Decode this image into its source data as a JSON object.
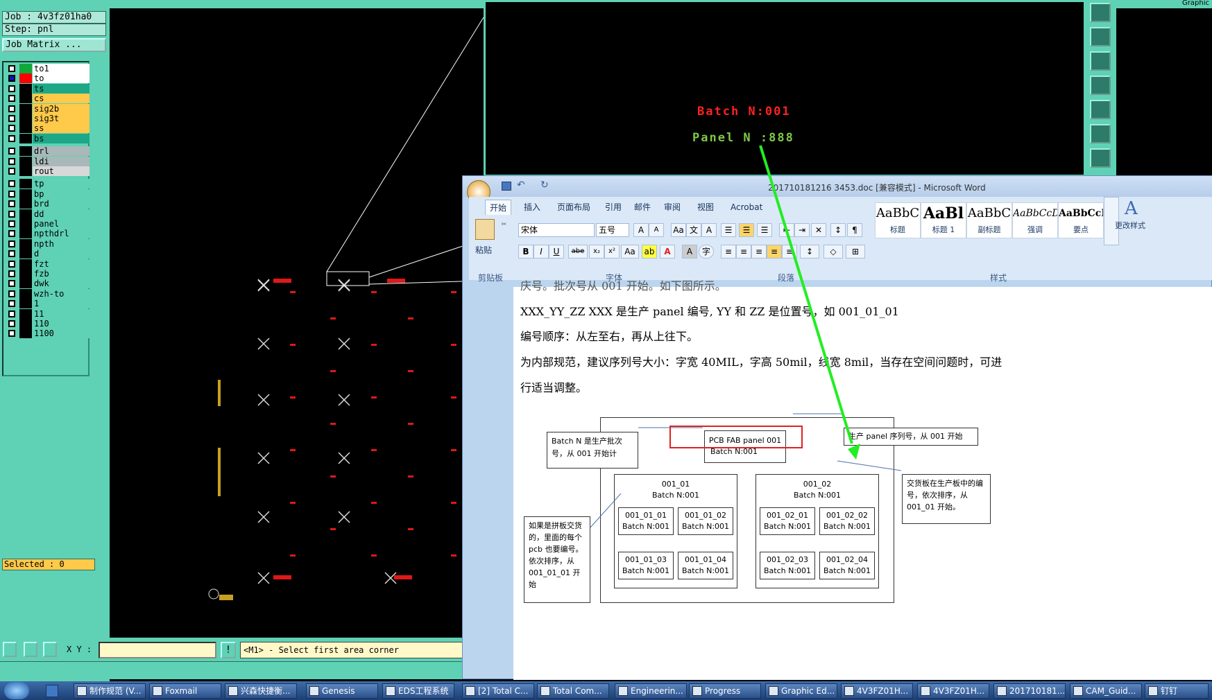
{
  "genesis": {
    "job_label": "Job : 4v3fz01ha0",
    "step_label": "Step: pnl",
    "job_matrix_button": "Job Matrix ...",
    "layers": [
      {
        "name": "to1",
        "color": "#ffffff",
        "swatch": "#11a83a"
      },
      {
        "name": "to",
        "color": "#ffffff",
        "swatch": "#ff0000"
      },
      {
        "name": "ts",
        "color": "#1ea888",
        "swatch": "#000000"
      },
      {
        "name": "cs",
        "color": "#ffc94a",
        "swatch": "#000000"
      },
      {
        "name": "sig2b",
        "color": "#ffc94a",
        "swatch": "#000000"
      },
      {
        "name": "sig3t",
        "color": "#ffc94a",
        "swatch": "#000000"
      },
      {
        "name": "ss",
        "color": "#ffc94a",
        "swatch": "#000000"
      },
      {
        "name": "bs",
        "color": "#1ea888",
        "swatch": "#000000"
      },
      {
        "name": "drl",
        "color": "#a9b8b8",
        "swatch": "#000000"
      },
      {
        "name": "ldi",
        "color": "#a9b8b8",
        "swatch": "#000000"
      },
      {
        "name": "rout",
        "color": "#d8d8d8",
        "swatch": "#000000"
      },
      {
        "name": "tp",
        "color": "#5fd1b4",
        "swatch": "#000000"
      },
      {
        "name": "bp",
        "color": "#5fd1b4",
        "swatch": "#000000"
      },
      {
        "name": "brd",
        "color": "#5fd1b4",
        "swatch": "#000000"
      },
      {
        "name": "dd",
        "color": "#5fd1b4",
        "swatch": "#000000"
      },
      {
        "name": "panel",
        "color": "#5fd1b4",
        "swatch": "#000000"
      },
      {
        "name": "npthdrl",
        "color": "#5fd1b4",
        "swatch": "#000000"
      },
      {
        "name": "npth",
        "color": "#5fd1b4",
        "swatch": "#000000"
      },
      {
        "name": "d",
        "color": "#5fd1b4",
        "swatch": "#000000"
      },
      {
        "name": "fzt",
        "color": "#5fd1b4",
        "swatch": "#000000"
      },
      {
        "name": "fzb",
        "color": "#5fd1b4",
        "swatch": "#000000"
      },
      {
        "name": "dwk",
        "color": "#5fd1b4",
        "swatch": "#000000"
      },
      {
        "name": "wzh-to",
        "color": "#5fd1b4",
        "swatch": "#000000"
      },
      {
        "name": "1",
        "color": "#5fd1b4",
        "swatch": "#000000"
      },
      {
        "name": "11",
        "color": "#5fd1b4",
        "swatch": "#000000"
      },
      {
        "name": "110",
        "color": "#5fd1b4",
        "swatch": "#000000"
      },
      {
        "name": "1100",
        "color": "#5fd1b4",
        "swatch": "#000000"
      }
    ],
    "selected_label": "Selected : 0",
    "xy_label": "X Y :",
    "xy_value": "",
    "prompt": "<M1> - Select first area corner"
  },
  "graphic": {
    "batch_text": "Batch N:001",
    "panel_text": "Panel N :888",
    "title_fragment": "Graphic"
  },
  "word": {
    "title": "201710181216 3453.doc [兼容模式] - Microsoft Word",
    "tabs": [
      "开始",
      "插入",
      "页面布局",
      "引用",
      "邮件",
      "审阅",
      "视图",
      "Acrobat"
    ],
    "paste_label": "粘贴",
    "clipboard_group": "剪贴板",
    "font_name": "宋体",
    "font_size": "五号",
    "font_group": "字体",
    "para_group": "段落",
    "styles_group": "样式",
    "change_styles": "更改样式",
    "styles": [
      {
        "preview": "AaBbC",
        "name": "标题"
      },
      {
        "preview": "AaBl",
        "name": "标题 1"
      },
      {
        "preview": "AaBbC",
        "name": "副标题"
      },
      {
        "preview": "AaBbCcD",
        "name": "强调"
      },
      {
        "preview": "AaBbCcD",
        "name": "要点"
      }
    ],
    "doc": {
      "cut_line": "庆号。批次号从 001 开始。如下图所示。",
      "line1": "XXX_YY_ZZ   XXX 是生产 panel 编号, YY  和  ZZ   是位置号，如 001_01_01",
      "line2": "编号顺序：从左至右，再从上往下。",
      "line3": "为内部规范，建议序列号大小：字宽 40MIL，字高 50mil，线宽 8mil，当存在空间问题时，可进",
      "line4": "行适当调整。",
      "note_batch": "Batch  N  是生产批次号，从 001 开始计",
      "pcb_title": "PCB  FAB  panel  001",
      "pcb_batch": "Batch N:001",
      "note_serial": "生产 panel  序列号，从 001 开始",
      "note_delivery": "交货板在生产板中的编号，依次排序，从 001_01 开始。",
      "note_pcb": "如果是拼板交货的，里面的每个 pcb 也要编号。依次排序，从 001_01_01 开始",
      "group1_title": "001_01",
      "group2_title": "001_02",
      "group_batch": "Batch N:001",
      "cells": [
        "001_01_01",
        "001_01_02",
        "001_01_03",
        "001_01_04",
        "001_02_01",
        "001_02_02",
        "001_02_03",
        "001_02_04"
      ],
      "cell_batch": "Batch N:001"
    }
  },
  "taskbar": {
    "items": [
      "制作规范 (V...",
      "Foxmail",
      "兴森快捷衡...",
      "Genesis",
      "EDS工程系统",
      "[2] Total C...",
      "Total Com...",
      "Engineerin...",
      "Progress",
      "Graphic Ed...",
      "4V3FZ01H...",
      "4V3FZ01H...",
      "201710181...",
      "CAM_Guid...",
      "钉钉"
    ]
  }
}
